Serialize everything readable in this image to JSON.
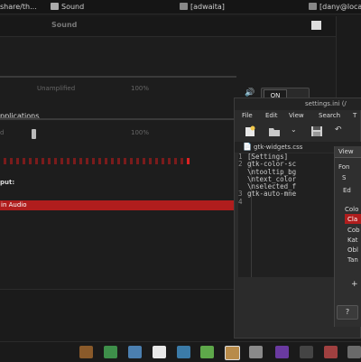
{
  "taskbar": {
    "tasks": [
      {
        "label": "share/th..."
      },
      {
        "label": "Sound"
      },
      {
        "label": "[adwaita]"
      },
      {
        "label": "[dany@loca"
      }
    ]
  },
  "sound_window": {
    "title": "Sound",
    "close_label": "x",
    "output_volume": {
      "unamplified_label": "Unamplified",
      "percent_label": "100%",
      "switch_label": "ON"
    },
    "applications_label": "pplications",
    "app_volume": {
      "zero_label": "d",
      "percent_label": "100%"
    },
    "output_label": "put:",
    "output_selected": "in Audio",
    "level_bars": 30
  },
  "editor": {
    "title": "settings.ini (/",
    "menu": [
      "File",
      "Edit",
      "View",
      "Search",
      "T"
    ],
    "tab_label": "gtk-widgets.css",
    "code_lines": [
      {
        "num": "1",
        "text": "[Settings]"
      },
      {
        "num": "2",
        "text": "gtk-color-sc"
      },
      {
        "num": "",
        "text": "\\ntooltip_bg"
      },
      {
        "num": "",
        "text": "\\ntext_color"
      },
      {
        "num": "",
        "text": "\\nselected_f"
      },
      {
        "num": "3",
        "text": "gtk-auto-mne"
      },
      {
        "num": "4",
        "text": ""
      }
    ]
  },
  "prefs_dialog": {
    "view_tab": "View",
    "labels": [
      "Fon",
      "S",
      "Ed",
      "Colo",
      "Cla",
      "Cob",
      "Kat",
      "Obl",
      "Tan"
    ],
    "add_label": "+",
    "help_label": "?"
  },
  "dock": {
    "items": [
      "menu-icon",
      "monitor-icon",
      "chat-icon",
      "document-icon",
      "calc-icon",
      "terminal-icon",
      "files-icon",
      "keyboard-icon",
      "glass-icon",
      "player-icon",
      "image-icon",
      "media-icon"
    ]
  }
}
